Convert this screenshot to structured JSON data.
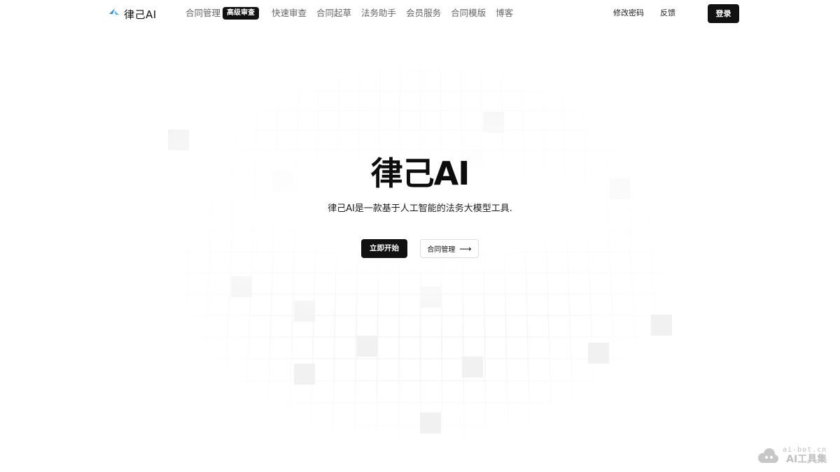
{
  "brand": {
    "name": "律己AI"
  },
  "nav": {
    "items": [
      {
        "label": "合同管理"
      },
      {
        "label": "快速审查"
      },
      {
        "label": "合同起草"
      },
      {
        "label": "法务助手"
      },
      {
        "label": "会员服务"
      },
      {
        "label": "合同模版"
      },
      {
        "label": "博客"
      }
    ],
    "badge": "高级审查"
  },
  "header_right": {
    "change_password": "修改密码",
    "feedback": "反馈",
    "login": "登录"
  },
  "hero": {
    "title": "律己AI",
    "subtitle": "律己AI是一款基于人工智能的法务大模型工具.",
    "start_button": "立即开始",
    "contract_button": "合同管理",
    "arrow": "⟶"
  },
  "watermark": {
    "url": "ai-bot.cn",
    "name": "AI工具集"
  },
  "colors": {
    "primary": "#111111",
    "logo_blue": "#2f8fd8",
    "nav_text": "#666666"
  }
}
